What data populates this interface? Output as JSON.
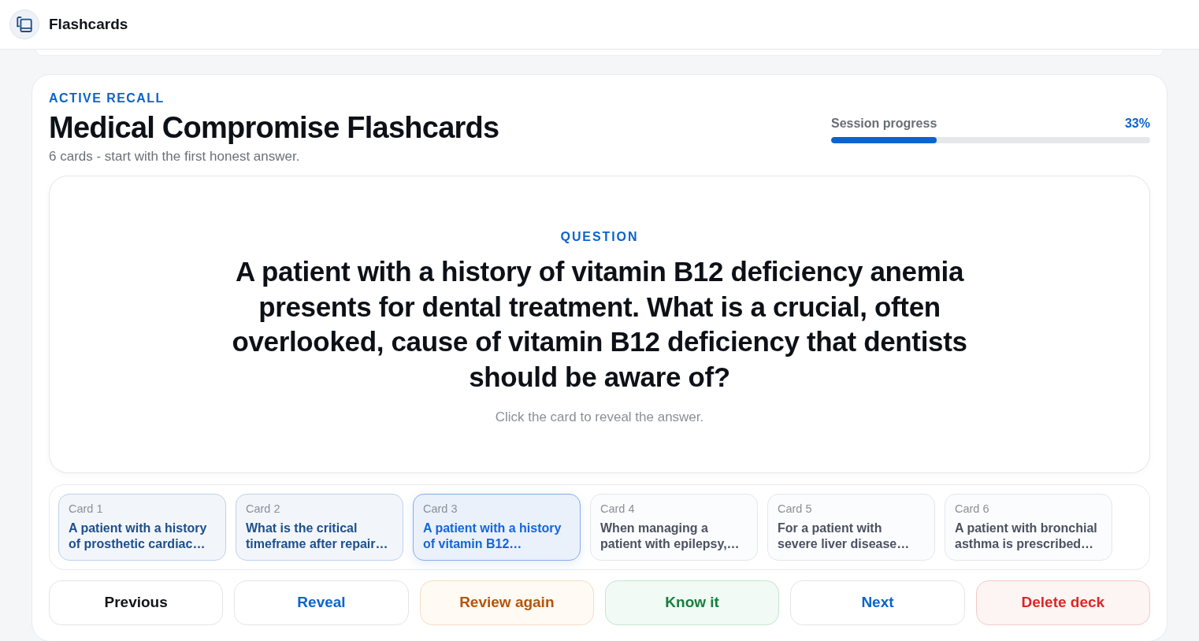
{
  "app": {
    "title": "Flashcards"
  },
  "deck": {
    "eyebrow": "ACTIVE RECALL",
    "title": "Medical Compromise Flashcards",
    "subtitle": "6 cards - start with the first honest answer.",
    "progress": {
      "label": "Session progress",
      "reading": "33%",
      "level": 0.33
    }
  },
  "question_card": {
    "label": "QUESTION",
    "text": "A patient with a history of vitamin B12 deficiency anemia presents for dental treatment. What is a crucial, often overlooked, cause of vitamin B12 deficiency that dentists should be aware of?",
    "hint": "Click the card to reveal the answer."
  },
  "cards": [
    {
      "label": "Card 1",
      "preview": "A patient with a history of prosthetic cardiac…",
      "seen": true,
      "selected": false
    },
    {
      "label": "Card 2",
      "preview": "What is the critical timeframe after repair…",
      "seen": true,
      "selected": false
    },
    {
      "label": "Card 3",
      "preview": "A patient with a history of vitamin B12…",
      "seen": false,
      "selected": true
    },
    {
      "label": "Card 4",
      "preview": "When managing a patient with epilepsy,…",
      "seen": false,
      "selected": false
    },
    {
      "label": "Card 5",
      "preview": "For a patient with severe liver disease…",
      "seen": false,
      "selected": false
    },
    {
      "label": "Card 6",
      "preview": "A patient with bronchial asthma is prescribed…",
      "seen": false,
      "selected": false
    }
  ],
  "actions": [
    {
      "label": "Previous",
      "kind": "neutral"
    },
    {
      "label": "Reveal",
      "kind": "primary"
    },
    {
      "label": "Review again",
      "kind": "warning"
    },
    {
      "label": "Know it",
      "kind": "success"
    },
    {
      "label": "Next",
      "kind": "primary"
    },
    {
      "label": "Delete deck",
      "kind": "danger"
    }
  ]
}
